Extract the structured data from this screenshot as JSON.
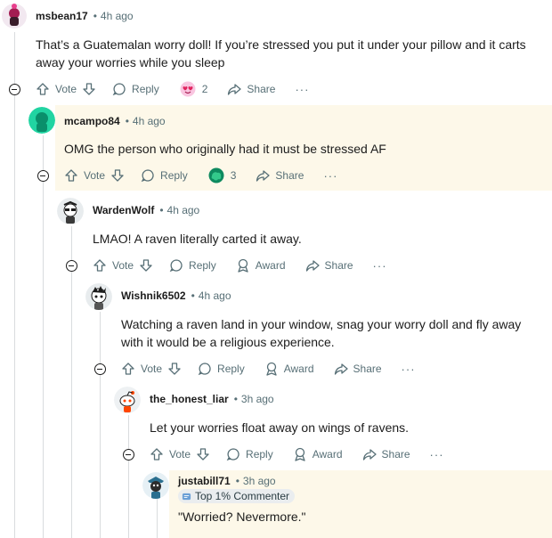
{
  "comments": [
    {
      "username": "msbean17",
      "time": "4h ago",
      "body": "That’s a Guatemalan worry doll! If you’re stressed you put it under your pillow and it carts away your worries while you sleep",
      "vote": "Vote",
      "reply": "Reply",
      "award_count": "2",
      "share": "Share"
    },
    {
      "username": "mcampo84",
      "time": "4h ago",
      "body": "OMG the person who originally had it must be stressed AF",
      "vote": "Vote",
      "reply": "Reply",
      "award_count": "3",
      "share": "Share"
    },
    {
      "username": "WardenWolf",
      "time": "4h ago",
      "body": "LMAO! A raven literally carted it away.",
      "vote": "Vote",
      "reply": "Reply",
      "award": "Award",
      "share": "Share"
    },
    {
      "username": "Wishnik6502",
      "time": "4h ago",
      "body": "Watching a raven land in your window, snag your worry doll and fly away with it would be a religious experience.",
      "vote": "Vote",
      "reply": "Reply",
      "award": "Award",
      "share": "Share"
    },
    {
      "username": "the_honest_liar",
      "time": "3h ago",
      "body": "Let your worries float away on wings of ravens.",
      "vote": "Vote",
      "reply": "Reply",
      "award": "Award",
      "share": "Share"
    },
    {
      "username": "justabill71",
      "time": "3h ago",
      "flair": "Top 1% Commenter",
      "body": "\"Worried? Nevermore.\""
    }
  ],
  "dot": "•",
  "more": "···",
  "colors": {
    "accent_highlight": "#fdf8e9",
    "meta": "#576f76",
    "text": "#1c1c1c"
  }
}
